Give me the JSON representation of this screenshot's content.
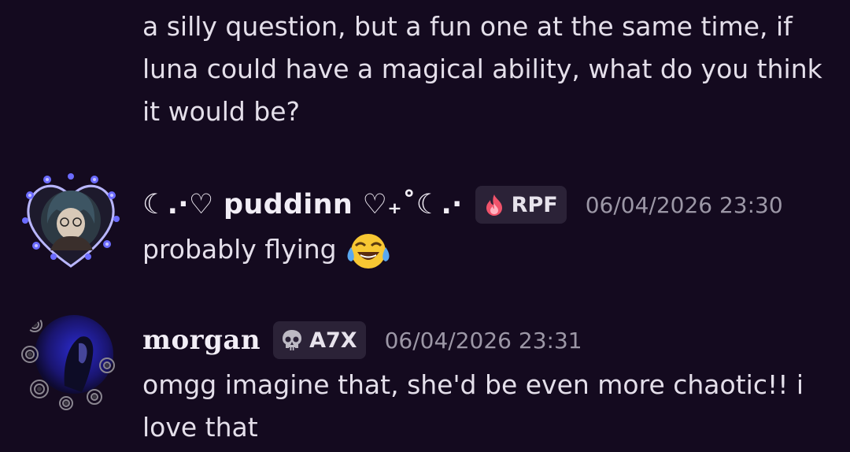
{
  "messages": [
    {
      "text": "a silly question, but a fun one at the same time, if luna could have a magical ability, what do you think it would be?"
    },
    {
      "username": "☾.·♡ puddinn ♡₊˚☾.·",
      "tag": "RPF",
      "tag_icon": "flame-icon",
      "timestamp": "06/04/2026 23:30",
      "text": "probably flying",
      "emoji": "face-with-tears-of-joy",
      "avatar": "avatar-heart-frame"
    },
    {
      "username": "morgan",
      "tag": "A7X",
      "tag_icon": "skull-icon",
      "timestamp": "06/04/2026 23:31",
      "text": "omgg imagine that, she'd be even more chaotic!! i love that",
      "avatar": "avatar-rose-frame"
    }
  ],
  "colors": {
    "background": "#140a1f",
    "text": "#e4dfea",
    "timestamp": "#9c97a6",
    "tag_bg": "#2b2237",
    "flame": "#f0536b"
  }
}
